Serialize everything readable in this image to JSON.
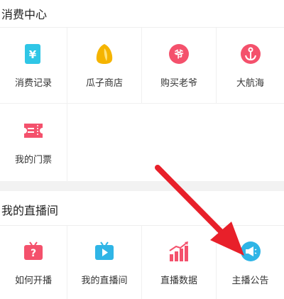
{
  "sections": [
    {
      "title": "消费中心",
      "items": [
        {
          "label": "消费记录",
          "icon": "wallet-yen-icon",
          "color": "#2fc6e6"
        },
        {
          "label": "瓜子商店",
          "icon": "melon-seed-icon",
          "color": "#f5b400"
        },
        {
          "label": "购买老爷",
          "icon": "ye-badge-icon",
          "color": "#f4516c"
        },
        {
          "label": "大航海",
          "icon": "anchor-icon",
          "color": "#f4516c"
        },
        {
          "label": "我的门票",
          "icon": "ticket-icon",
          "color": "#f4516c"
        }
      ]
    },
    {
      "title": "我的直播间",
      "items": [
        {
          "label": "如何开播",
          "icon": "tv-question-icon",
          "color": "#f4516c"
        },
        {
          "label": "我的直播间",
          "icon": "tv-play-icon",
          "color": "#2fb5e6"
        },
        {
          "label": "直播数据",
          "icon": "chart-bars-icon",
          "color": "#f4516c"
        },
        {
          "label": "主播公告",
          "icon": "megaphone-icon",
          "color": "#2fb5e6"
        }
      ]
    }
  ],
  "colors": {
    "annotation_arrow": "#e8202a"
  }
}
